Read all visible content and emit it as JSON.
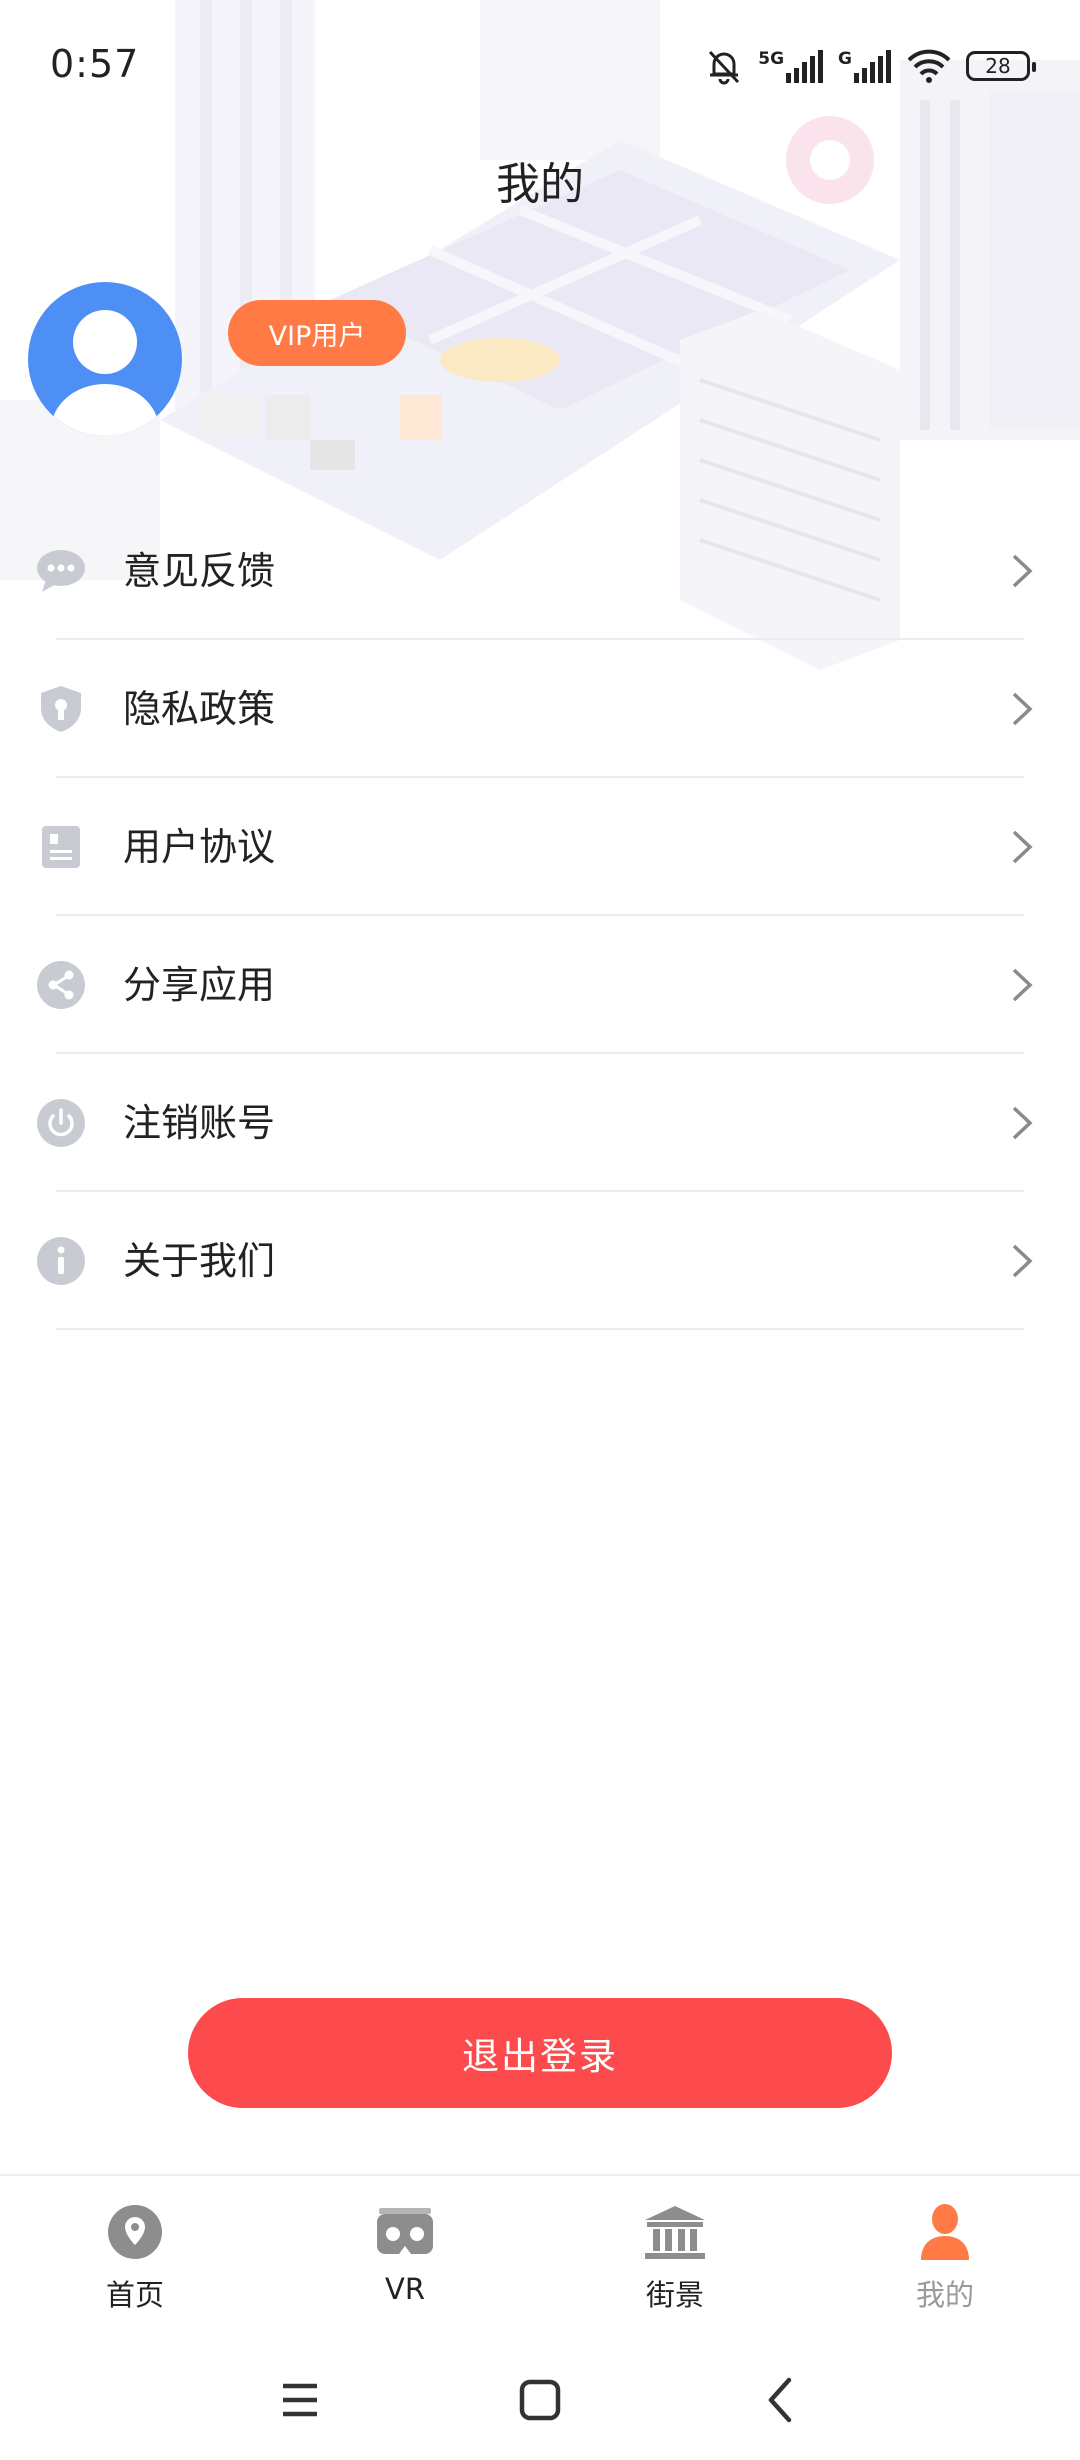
{
  "status_bar": {
    "time": "0:57",
    "network_1": "5G",
    "network_2": "G",
    "battery": "28",
    "icons": [
      "mute-bell-icon",
      "signal-icon",
      "signal-icon",
      "wifi-icon",
      "battery-icon"
    ]
  },
  "header": {
    "title": "我的"
  },
  "profile": {
    "avatar_icon": "user-avatar-icon",
    "badge": "VIP用户",
    "avatar_color": "#4e8ff5",
    "badge_color": "#ff7a45"
  },
  "menu": {
    "items": [
      {
        "label": "意见反馈",
        "icon": "chat-bubble-icon"
      },
      {
        "label": "隐私政策",
        "icon": "shield-icon"
      },
      {
        "label": "用户协议",
        "icon": "document-icon"
      },
      {
        "label": "分享应用",
        "icon": "share-icon"
      },
      {
        "label": "注销账号",
        "icon": "power-icon"
      },
      {
        "label": "关于我们",
        "icon": "info-icon"
      }
    ]
  },
  "logout": {
    "label": "退出登录",
    "color": "#fd4a4c"
  },
  "tabbar": {
    "tabs": [
      {
        "label": "首页",
        "icon": "location-pin-icon"
      },
      {
        "label": "VR",
        "icon": "vr-headset-icon"
      },
      {
        "label": "街景",
        "icon": "building-icon"
      },
      {
        "label": "我的",
        "icon": "person-icon",
        "active": true
      }
    ],
    "accent": "#ff7a45"
  },
  "navbar": {
    "icons": [
      "menu-icon",
      "home-square-icon",
      "back-icon"
    ]
  }
}
